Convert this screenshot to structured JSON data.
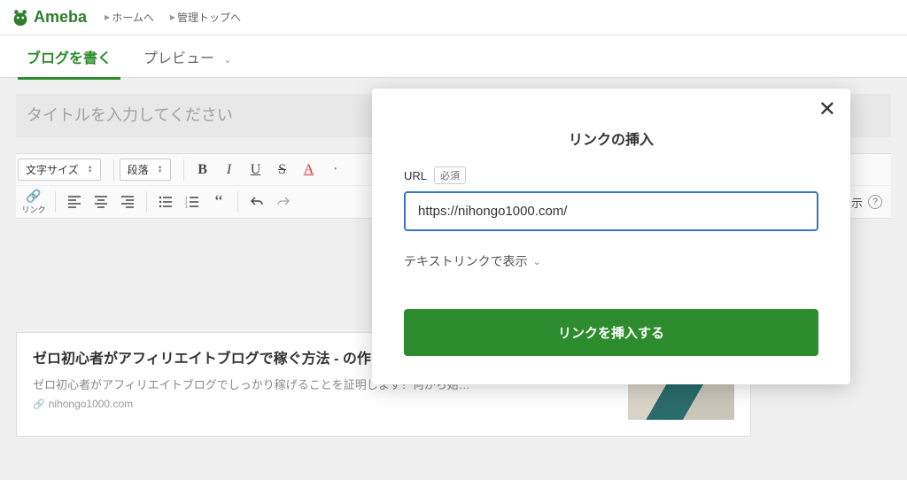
{
  "header": {
    "logo_text": "Ameba",
    "links": [
      "ホームへ",
      "管理トップへ"
    ]
  },
  "tabs": {
    "write": "ブログを書く",
    "preview": "プレビュー"
  },
  "title_placeholder": "タイトルを入力してください",
  "toolbar": {
    "font_size": "文字サイズ",
    "paragraph": "段落",
    "link_label": "リンク",
    "display_width": "幅で表示"
  },
  "card": {
    "title": "ゼロ初心者がアフィリエイトブログで稼ぐ方法 - の作り方と始め方を図解します。",
    "desc": "ゼロ初心者がアフィリエイトブログでしっかり稼げることを証明します！何から始…",
    "domain": "nihongo1000.com"
  },
  "modal": {
    "title": "リンクの挿入",
    "url_label": "URL",
    "required": "必須",
    "url_value": "https://nihongo1000.com/",
    "display_as": "テキストリンクで表示",
    "insert_button": "リンクを挿入する"
  }
}
